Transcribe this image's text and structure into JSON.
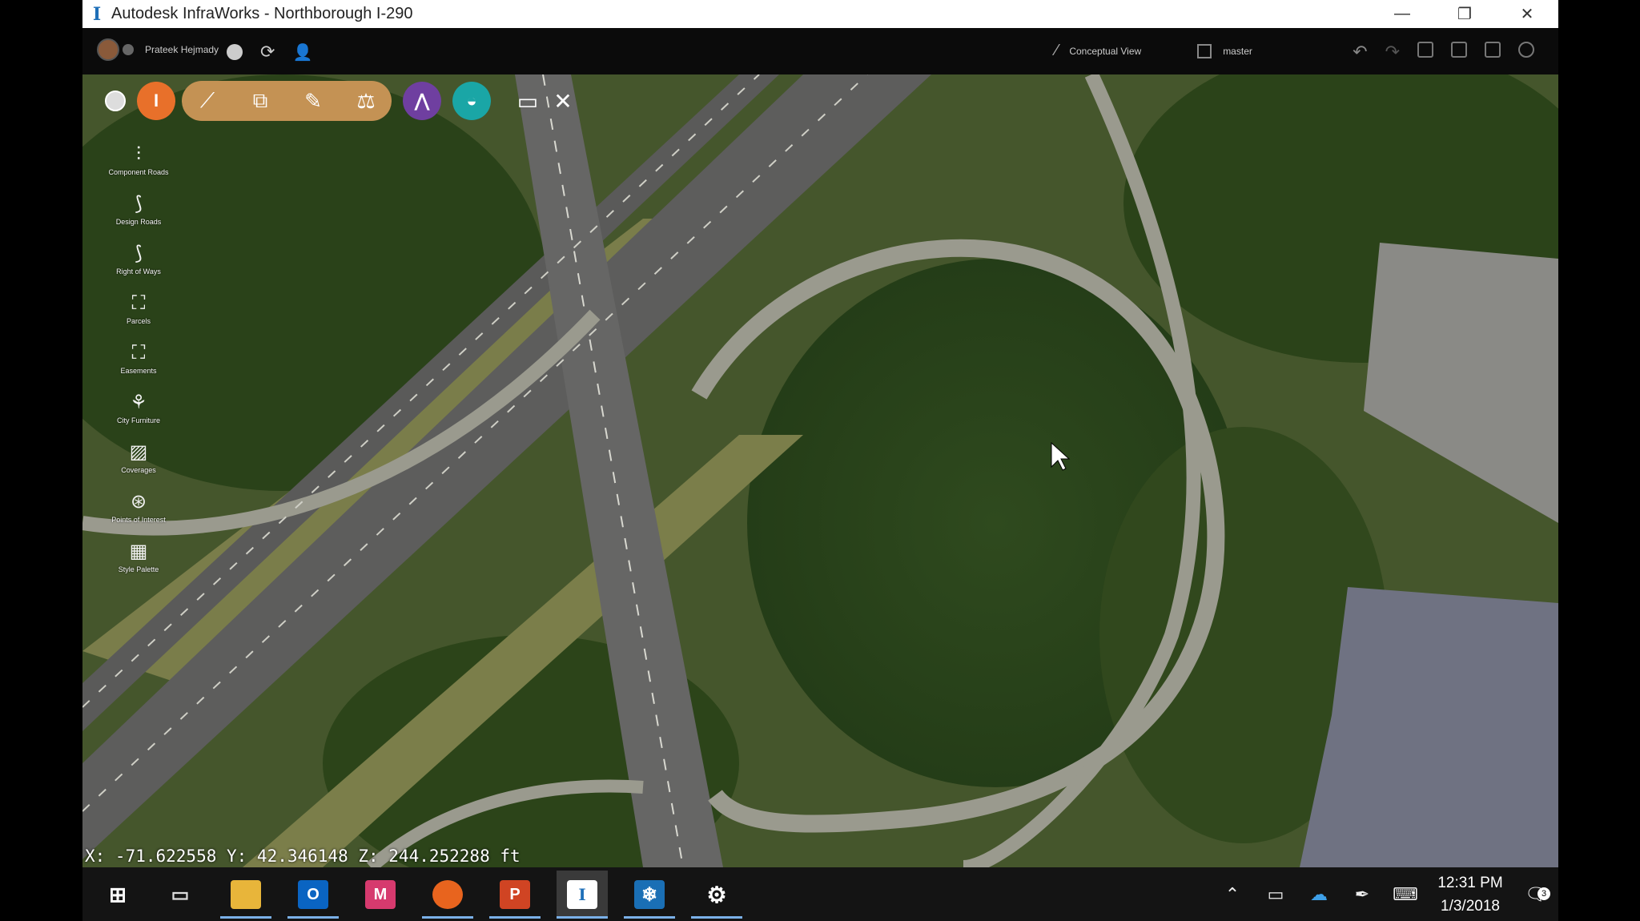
{
  "window": {
    "title": "Autodesk InfraWorks - Northborough I-290",
    "app_icon": "infraworks-icon",
    "controls": [
      "minimize-icon",
      "restore-icon",
      "close-icon"
    ]
  },
  "header": {
    "user_name": "Prateek Hejmady",
    "view_label": "Conceptual View",
    "branch_label": "master"
  },
  "toolbar": {
    "home_icon": "home-icon",
    "groups": [
      "infrastructure-icon",
      "roads-pill",
      "bridges-icon",
      "drainage-icon",
      "presentation-icon",
      "settings-tools-icon"
    ],
    "colors": {
      "orange": "#e8702a",
      "tan": "#c49254",
      "purple": "#6f3fa0",
      "teal": "#1aa6a6"
    }
  },
  "left_panel": {
    "items": [
      {
        "label": "Component Roads",
        "icon": "component-roads-icon"
      },
      {
        "label": "Design Roads",
        "icon": "design-roads-icon"
      },
      {
        "label": "Right of Ways",
        "icon": "right-of-ways-icon"
      },
      {
        "label": "Parcels",
        "icon": "parcels-icon"
      },
      {
        "label": "Easements",
        "icon": "easements-icon"
      },
      {
        "label": "City Furniture",
        "icon": "city-furniture-icon"
      },
      {
        "label": "Coverages",
        "icon": "coverages-icon"
      },
      {
        "label": "Points of Interest",
        "icon": "points-of-interest-icon"
      },
      {
        "label": "Style Palette",
        "icon": "style-palette-icon"
      }
    ]
  },
  "status": {
    "coordinates": "X: -71.622558 Y: 42.346148 Z: 244.252288 ft"
  },
  "taskbar": {
    "apps": [
      "start-icon",
      "task-view-icon",
      "file-explorer-icon",
      "outlook-icon",
      "app-m-icon",
      "firefox-icon",
      "powerpoint-icon",
      "infraworks-icon",
      "snowflake-app-icon",
      "settings-icon"
    ],
    "time": "12:31 PM",
    "date": "1/3/2018",
    "notification_count": "3"
  }
}
